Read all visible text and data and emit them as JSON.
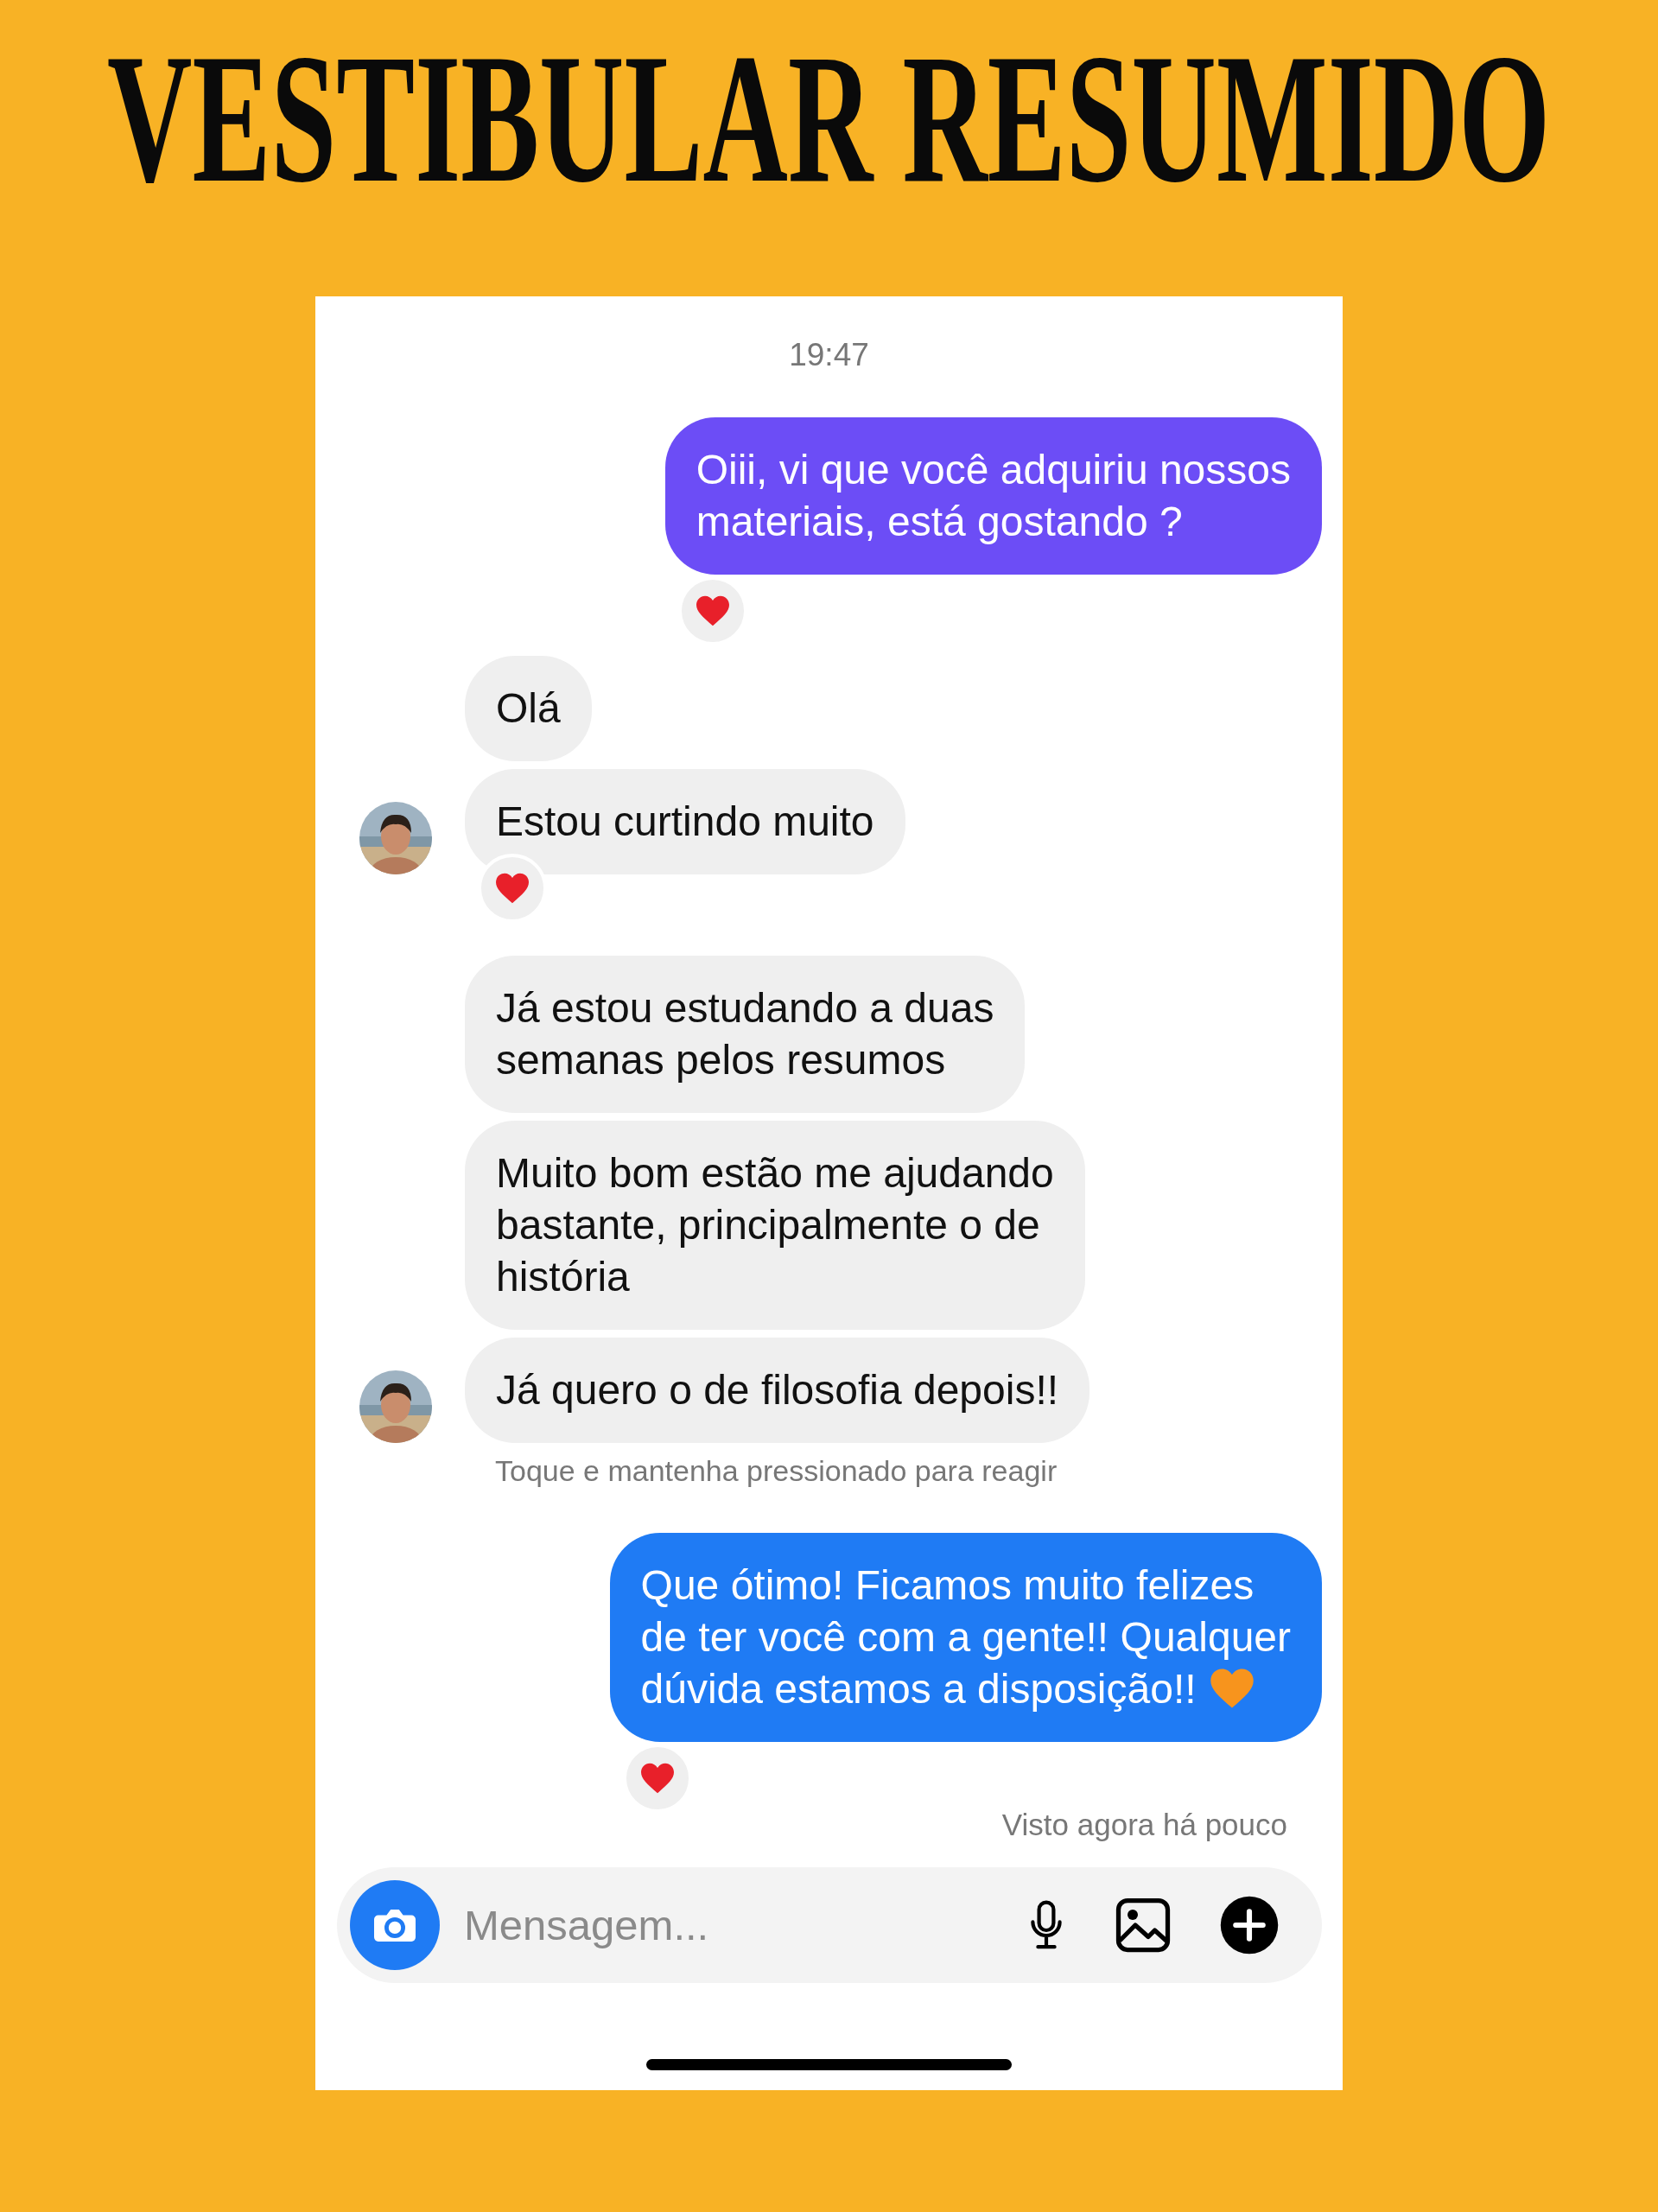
{
  "title": "VESTIBULAR RESUMIDO",
  "chat": {
    "timestamp": "19:47",
    "messages": [
      {
        "kind": "outgoing",
        "color": "#6c4df6",
        "text": "Oiii, vi que você adquiriu nossos\nmateriais, está gostando ?",
        "reaction": true
      },
      {
        "kind": "incoming",
        "text": "Olá"
      },
      {
        "kind": "incoming",
        "text": "Estou curtindo muito",
        "reaction": true,
        "avatar": true
      },
      {
        "kind": "incoming",
        "text": "Já estou estudando a duas\nsemanas pelos resumos"
      },
      {
        "kind": "incoming",
        "text": "Muito bom estão me ajudando\nbastante, principalmente o de\nhistória"
      },
      {
        "kind": "incoming",
        "text": "Já quero o de filosofia depois!!",
        "avatar": true,
        "hint": "Toque e mantenha pressionado para reagir"
      },
      {
        "kind": "outgoing",
        "color": "#1f7bf4",
        "text": "Que ótimo! Ficamos muito felizes\nde ter você com a gente!! Qualquer\ndúvida estamos a disposição!!",
        "end_heart": true,
        "reaction": true
      }
    ],
    "seen": "Visto agora há pouco",
    "composer": {
      "placeholder": "Mensagem..."
    }
  }
}
